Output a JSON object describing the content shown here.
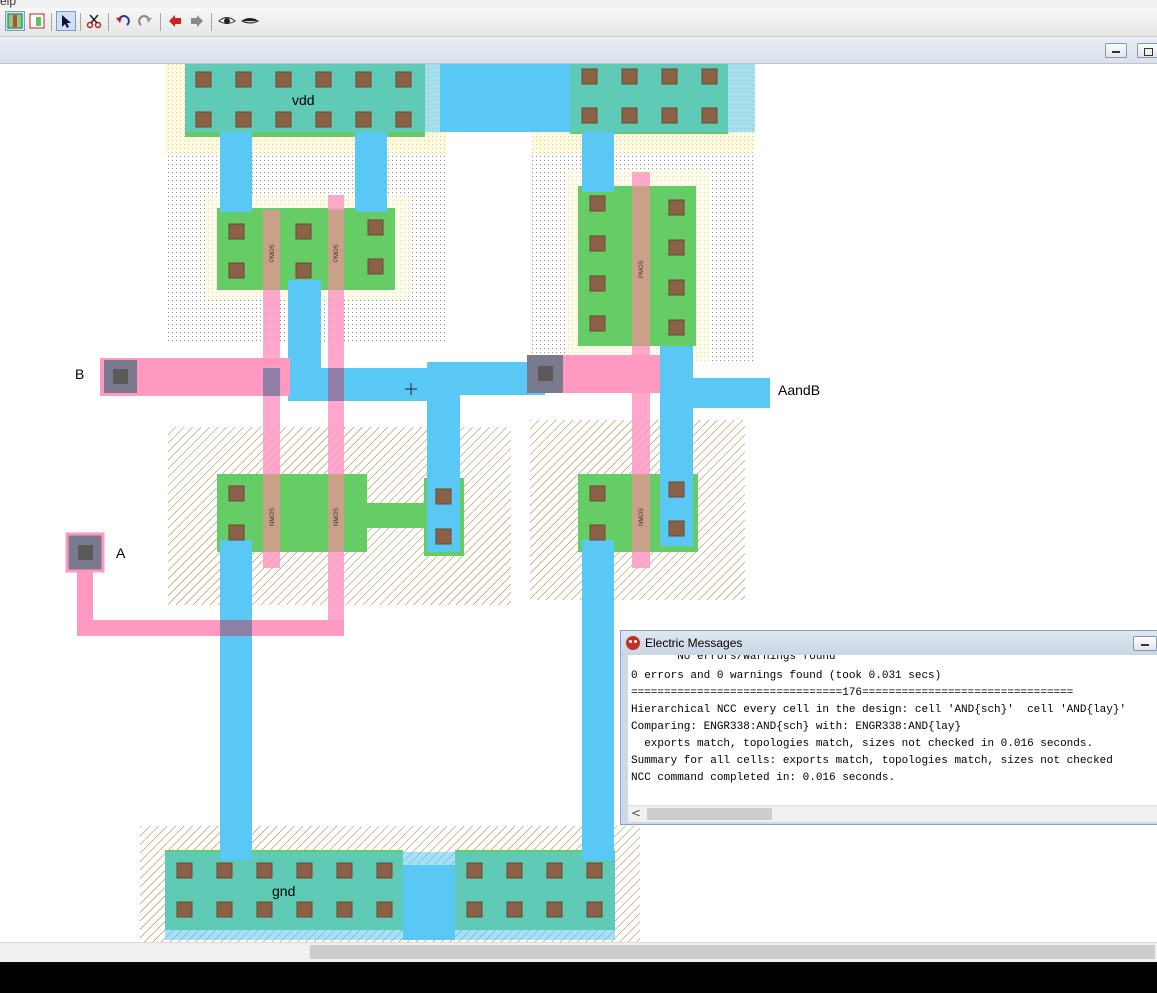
{
  "menubar": {
    "partial_label": "elp"
  },
  "toolbar": {
    "buttons": [
      {
        "name": "click-mode-button",
        "icon": "click-mode-icon"
      },
      {
        "name": "edit-mode-button",
        "icon": "edit-mode-icon"
      },
      {
        "name": "select-arrow-button",
        "icon": "arrow-cursor-icon"
      },
      {
        "name": "cut-tool-button",
        "icon": "scissors-icon"
      },
      {
        "name": "undo-button",
        "icon": "undo-icon"
      },
      {
        "name": "redo-button",
        "icon": "redo-icon"
      },
      {
        "name": "back-button",
        "icon": "red-left-arrow-icon"
      },
      {
        "name": "forward-button",
        "icon": "gray-right-arrow-icon"
      },
      {
        "name": "expand-button",
        "icon": "eye-icon"
      },
      {
        "name": "unexpand-button",
        "icon": "closed-eye-icon"
      }
    ]
  },
  "layout_editor": {
    "exports": {
      "vdd": "vdd",
      "gnd": "gnd",
      "a": "A",
      "b": "B",
      "out": "AandB"
    },
    "transistor_labels": {
      "pmos_1": "PMOS",
      "pmos_2": "PMOS",
      "pmos_3": "PMOS",
      "nmos_1": "NMOS",
      "nmos_2": "NMOS",
      "nmos_3": "NMOS"
    },
    "colors": {
      "metal1": "#5ac8f5",
      "poly": "#ff99c2",
      "active": "#66cc66",
      "contact": "#8b6247",
      "pwell_hatch": "#a07830",
      "nwell_dots": "#999999",
      "pin": "#7a7a8e"
    }
  },
  "messages_window": {
    "title": "Electric Messages",
    "lines": [
      "       No errors/warnings found",
      "0 errors and 0 warnings found (took 0.031 secs)",
      "================================176================================",
      "Hierarchical NCC every cell in the design: cell 'AND{sch}'  cell 'AND{lay}'",
      "Comparing: ENGR338:AND{sch} with: ENGR338:AND{lay}",
      "  exports match, topologies match, sizes not checked in 0.016 seconds.",
      "Summary for all cells: exports match, topologies match, sizes not checked",
      "NCC command completed in: 0.016 seconds."
    ],
    "scroll_left_glyph": "<"
  }
}
